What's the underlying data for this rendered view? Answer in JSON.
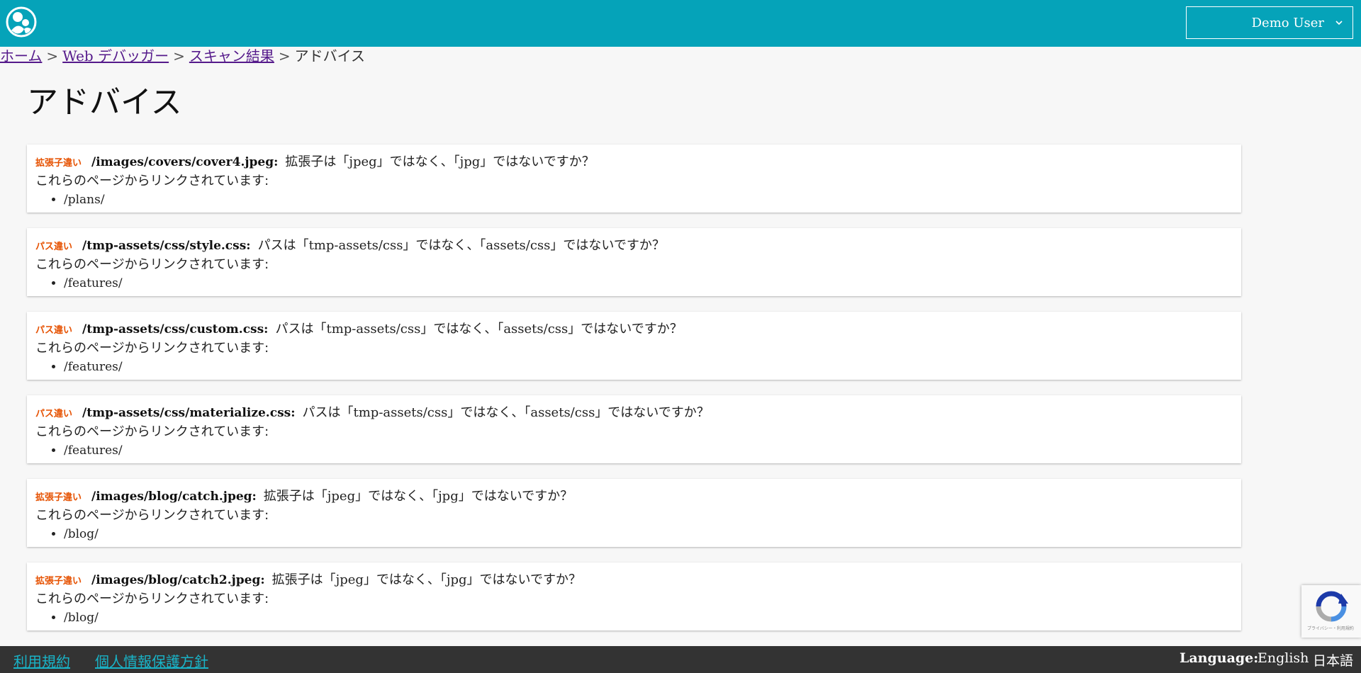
{
  "header": {
    "user_label": "Demo User",
    "bg_color": "#05a3b9"
  },
  "breadcrumb": {
    "home": "ホーム",
    "debugger": "Web デバッガー",
    "results": "スキャン結果",
    "current": "アドバイス",
    "separator": ">"
  },
  "page": {
    "title": "アドバイス"
  },
  "advice": [
    {
      "tag": "拡張子違い",
      "path": "/images/covers/cover4.jpeg:",
      "message": "拡張子は「jpeg」ではなく、「jpg」ではないですか？",
      "linked_label": "これらのページからリンクされています:",
      "refs": [
        "/plans/"
      ]
    },
    {
      "tag": "パス違い",
      "path": "/tmp-assets/css/style.css:",
      "message": "パスは「tmp-assets/css」ではなく、「assets/css」ではないですか？",
      "linked_label": "これらのページからリンクされています:",
      "refs": [
        "/features/"
      ]
    },
    {
      "tag": "パス違い",
      "path": "/tmp-assets/css/custom.css:",
      "message": "パスは「tmp-assets/css」ではなく、「assets/css」ではないですか？",
      "linked_label": "これらのページからリンクされています:",
      "refs": [
        "/features/"
      ]
    },
    {
      "tag": "パス違い",
      "path": "/tmp-assets/css/materialize.css:",
      "message": "パスは「tmp-assets/css」ではなく、「assets/css」ではないですか？",
      "linked_label": "これらのページからリンクされています:",
      "refs": [
        "/features/"
      ]
    },
    {
      "tag": "拡張子違い",
      "path": "/images/blog/catch.jpeg:",
      "message": "拡張子は「jpeg」ではなく、「jpg」ではないですか？",
      "linked_label": "これらのページからリンクされています:",
      "refs": [
        "/blog/"
      ]
    },
    {
      "tag": "拡張子違い",
      "path": "/images/blog/catch2.jpeg:",
      "message": "拡張子は「jpeg」ではなく、「jpg」ではないですか？",
      "linked_label": "これらのページからリンクされています:",
      "refs": [
        "/blog/"
      ]
    }
  ],
  "footer": {
    "terms": "利用規約",
    "privacy": "個人情報保護方針",
    "language_label": "Language:",
    "lang_en": "English",
    "lang_ja": "日本語"
  },
  "recaptcha": {
    "text": "プライバシー・利用規約"
  },
  "icons": {
    "logo": "person-logo-icon",
    "caret": "chevron-down-icon",
    "recaptcha": "recaptcha-icon"
  }
}
